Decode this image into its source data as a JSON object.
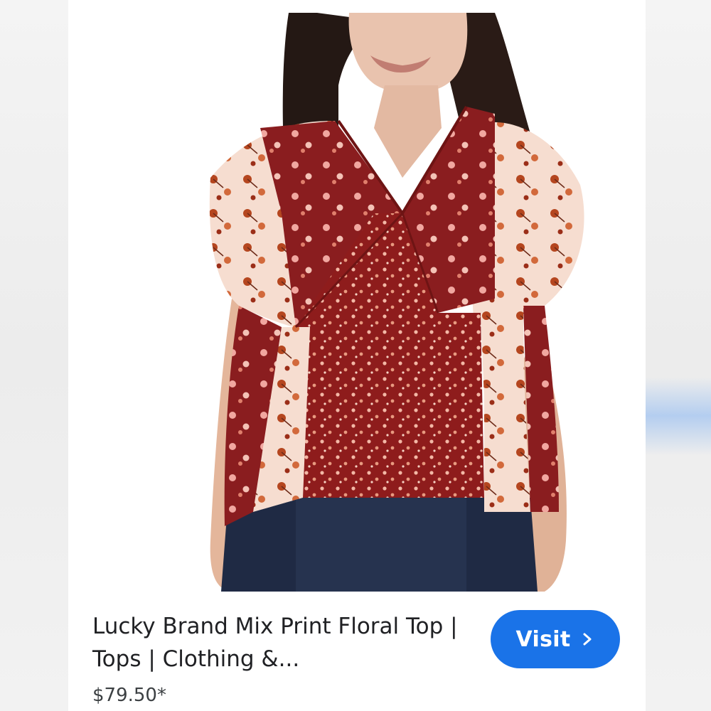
{
  "result": {
    "title": "Lucky Brand Mix Print Floral Top | Tops | Clothing &...",
    "price": "$79.50*",
    "visit_label": "Visit",
    "image_subject": "woman wearing red and blush mixed floral print flutter-sleeve top"
  },
  "colors": {
    "accent": "#1a73e8",
    "title_text": "#202124",
    "price_text": "#3c4043",
    "burgundy": "#8e1c1c",
    "blush": "#f6ddd0"
  },
  "icons": {
    "visit_chevron": "chevron-right-icon"
  }
}
